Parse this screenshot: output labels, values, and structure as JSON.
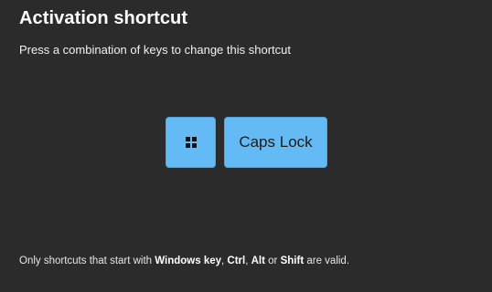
{
  "dialog": {
    "title": "Activation shortcut",
    "subtitle": "Press a combination of keys to change this shortcut"
  },
  "keys": {
    "win": {
      "icon": "windows-logo-icon"
    },
    "caps": {
      "label": "Caps Lock"
    }
  },
  "footnote": {
    "prefix": "Only shortcuts that start with ",
    "key1": "Windows key",
    "sep1": ", ",
    "key2": "Ctrl",
    "sep2": ", ",
    "key3": "Alt",
    "sep3": " or ",
    "key4": "Shift",
    "suffix": " are valid."
  },
  "colors": {
    "background": "#2b2b2b",
    "key_fill": "#63baf5",
    "key_border": "#4ea3de",
    "text": "#ffffff"
  }
}
